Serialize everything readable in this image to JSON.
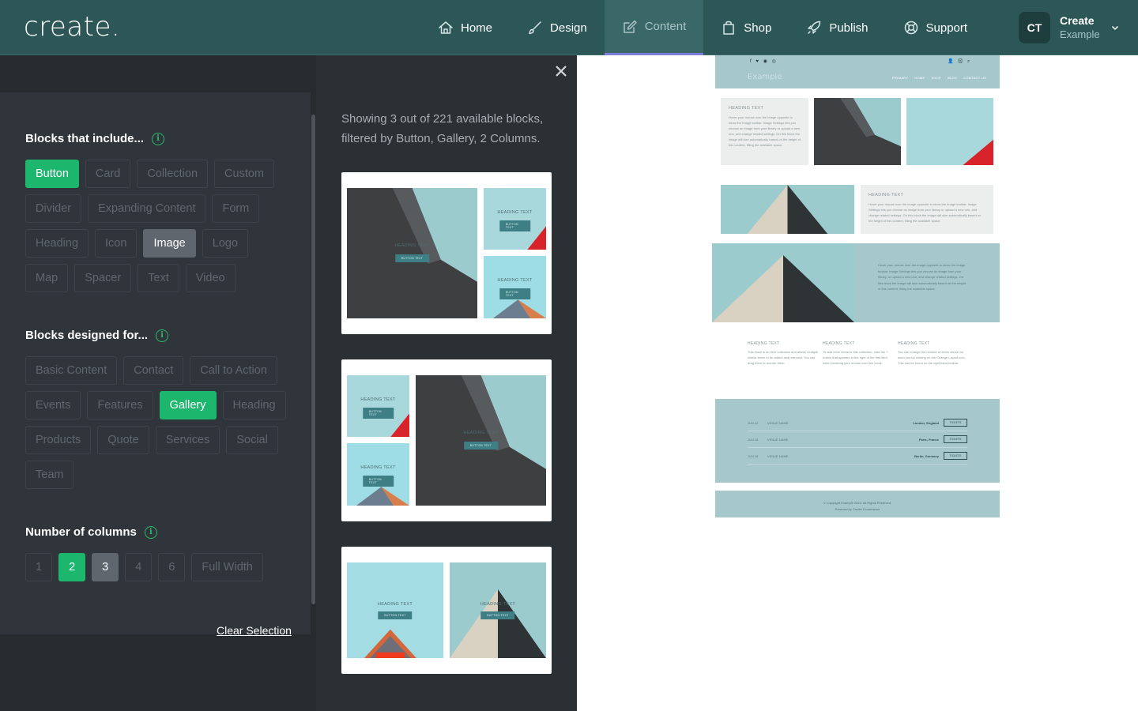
{
  "app": {
    "logo": "create."
  },
  "nav": [
    {
      "label": "Home",
      "icon": "home-icon"
    },
    {
      "label": "Design",
      "icon": "brush-icon"
    },
    {
      "label": "Content",
      "icon": "edit-icon",
      "active": true
    },
    {
      "label": "Shop",
      "icon": "bag-icon"
    },
    {
      "label": "Publish",
      "icon": "rocket-icon"
    },
    {
      "label": "Support",
      "icon": "lifebuoy-icon"
    }
  ],
  "user": {
    "initials": "CT",
    "name": "Create",
    "site": "Example"
  },
  "filters": {
    "include": {
      "title": "Blocks that include...",
      "chips": [
        "Button",
        "Card",
        "Collection",
        "Custom",
        "Divider",
        "Expanding Content",
        "Form",
        "Heading",
        "Icon",
        "Image",
        "Logo",
        "Map",
        "Spacer",
        "Text",
        "Video"
      ],
      "selected": [
        "Button"
      ],
      "highlighted": [
        "Image"
      ]
    },
    "designed": {
      "title": "Blocks designed for...",
      "chips": [
        "Basic Content",
        "Contact",
        "Call to Action",
        "Events",
        "Features",
        "Gallery",
        "Heading",
        "Products",
        "Quote",
        "Services",
        "Social",
        "Team"
      ],
      "selected": [
        "Gallery"
      ],
      "highlighted": []
    },
    "columns": {
      "title": "Number of columns",
      "chips": [
        "1",
        "2",
        "3",
        "4",
        "6",
        "Full Width"
      ],
      "selected": [
        "2"
      ],
      "highlighted": [
        "3"
      ]
    },
    "clear_label": "Clear Selection"
  },
  "results": {
    "summary": "Showing 3 out of 221 available blocks, filtered by Button, Gallery, 2 Columns.",
    "tile_heading": "HEADING TEXT",
    "tile_button": "BUTTON TEXT"
  },
  "preview": {
    "social": "f ♥ ◉ ◎",
    "tools": "👤 ⛒ ⌕",
    "logo": "Example",
    "nav": [
      "PRIMARY",
      "HOME",
      "SHOP",
      "BLOG",
      "CONTACT US"
    ],
    "heading": "HEADING TEXT",
    "body": "Hover your mouse over the image opposite to show the Image toolbar. Image Settings lets you choose an image from your library or upload a new one, and change related settings. On this block the image will size automatically based on the height of this content, filling the available space.",
    "wide_body": "Hover your mouse over the image opposite to show the Image toolbar. Image Settings lets you choose an image from your library, or upload a new one, and change related settings. On this block the image will size automatically based on the height of this content, filling the available space.",
    "columns": [
      {
        "heading": "HEADING TEXT",
        "body": "This block is an item collection and allows multiple similar items to be added and removed. You can drag them to reorder them."
      },
      {
        "heading": "HEADING TEXT",
        "body": "To add more items to this collection, click the + button that appears to the right of the first item when hovering your mouse over this block."
      },
      {
        "heading": "HEADING TEXT",
        "body": "You can change the number of items shown on each row by clicking on the Change Layout icon. This can be found on the right hand toolbar."
      }
    ],
    "events": [
      {
        "date": "JUN 12",
        "venue": "VENUE NAME",
        "city": "London, England",
        "button": "TICKETS"
      },
      {
        "date": "JUN 15",
        "venue": "VENUE NAME",
        "city": "Paris, France",
        "button": "TICKETS"
      },
      {
        "date": "JUN 18",
        "venue": "VENUE NAME",
        "city": "Berlin, Germany",
        "button": "TICKETS"
      }
    ],
    "footer_line1": "© Copyright Example 2023. All Rights Reserved.",
    "footer_line2": "Powered by Create Ecommerce"
  },
  "colors": {
    "topbar": "#2d5757",
    "accent_green": "#1db66d",
    "active_underline": "#7f7bd9",
    "preview_teal": "#a6c8cb"
  }
}
